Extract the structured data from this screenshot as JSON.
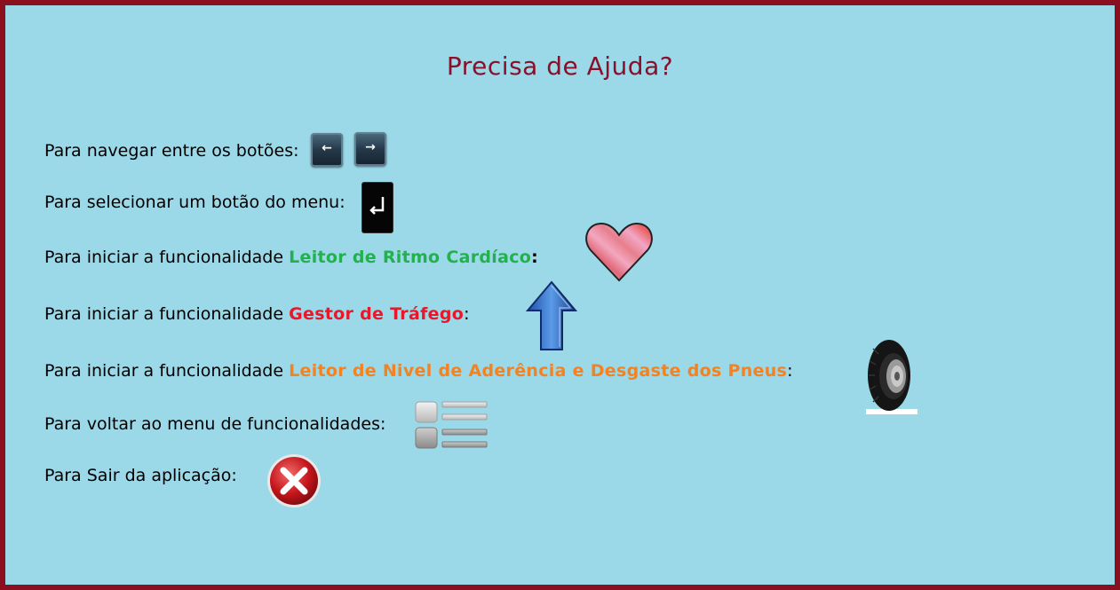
{
  "title": "Precisa de Ajuda?",
  "rows": {
    "navigate": {
      "text": "Para navegar entre os botões:"
    },
    "select": {
      "text": "Para selecionar um botão do menu:"
    },
    "heart": {
      "prefix": "Para iniciar a funcionalidade ",
      "feature": "Leitor de Ritmo Cardíaco",
      "suffix": ":"
    },
    "traffic": {
      "prefix": "Para iniciar a funcionalidade ",
      "feature": "Gestor de Tráfego",
      "suffix": ":"
    },
    "tyres": {
      "prefix": "Para iniciar a funcionalidade ",
      "feature": "Leitor de Nivel de Aderência e Desgaste dos Pneus",
      "suffix": ":"
    },
    "menu": {
      "text": "Para voltar ao menu de funcionalidades:"
    },
    "exit": {
      "text": "Para Sair da aplicação:"
    }
  },
  "icons": {
    "left_arrow_key": "left-arrow-key-icon",
    "right_arrow_key": "right-arrow-key-icon",
    "enter_key": "enter-key-icon",
    "heart": "heart-icon",
    "up_arrow": "up-arrow-icon",
    "tyre": "tyre-icon",
    "menu_list": "menu-list-icon",
    "close": "close-icon"
  },
  "colors": {
    "border": "#8a0f1f",
    "background": "#9bd8e8",
    "title": "#8a0f2a",
    "heart_feature": "#22b14c",
    "traffic_feature": "#e8182a",
    "tyres_feature": "#f58220"
  }
}
